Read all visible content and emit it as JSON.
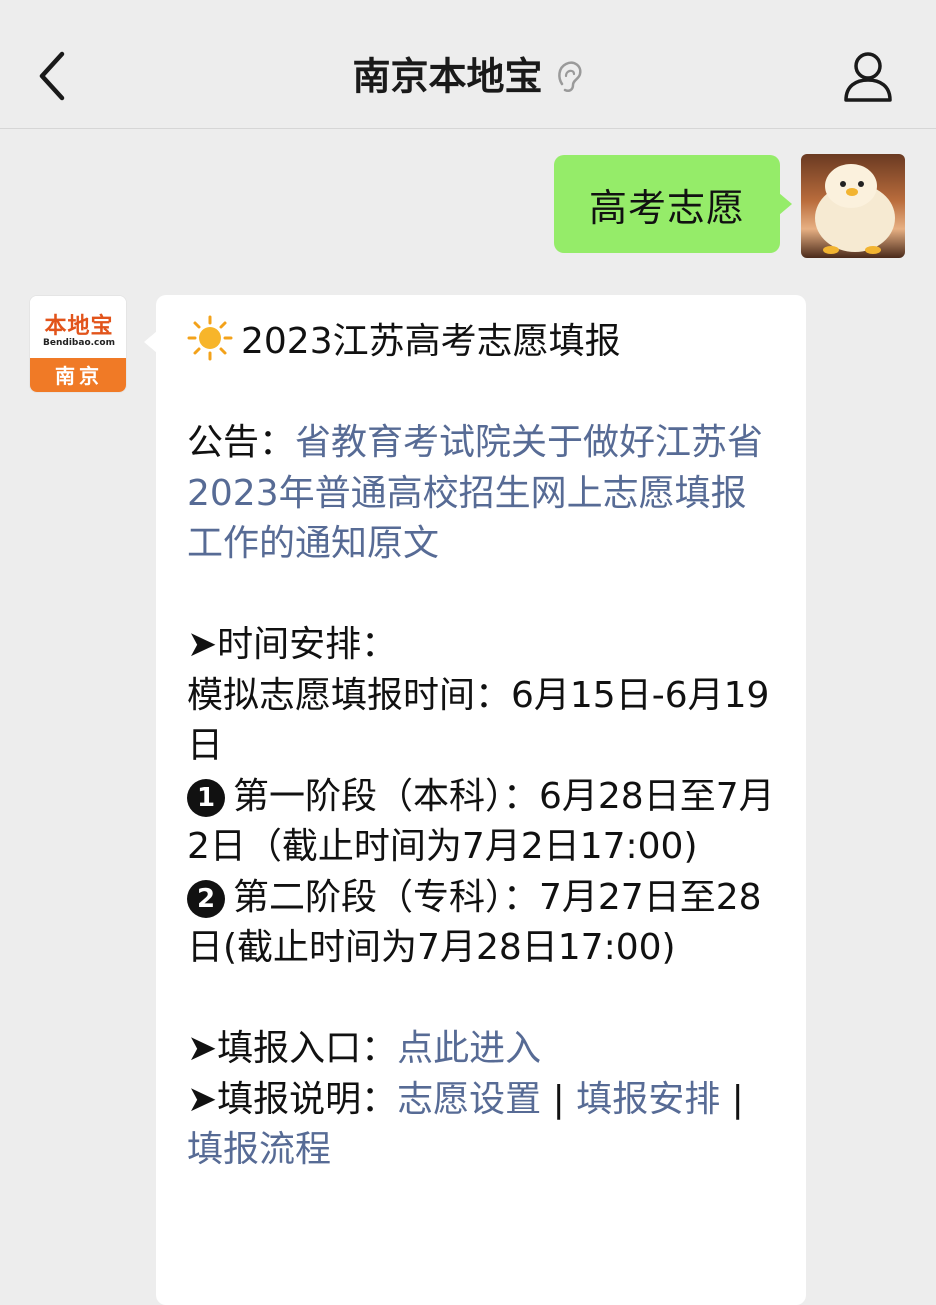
{
  "header": {
    "title": "南京本地宝",
    "back_icon": "chevron-left-icon",
    "ear_icon": "ear-icon",
    "profile_icon": "person-icon"
  },
  "user_message": {
    "text": "高考志愿"
  },
  "bot": {
    "avatar": {
      "brand": "本地宝",
      "domain": "Bendibao.com",
      "city": "南京"
    },
    "title": "2023江苏高考志愿填报",
    "notice_label": "公告：",
    "notice_link": "省教育考试院关于做好江苏省2023年普通高校招生网上志愿填报工作的通知原文",
    "schedule_heading": "➤时间安排：",
    "schedule_sim": "模拟志愿填报时间：6月15日-6月19日",
    "stage1_num": "1",
    "stage1": "第一阶段（本科）：6月28日至7月2日（截止时间为7月2日17:00)",
    "stage2_num": "2",
    "stage2": "第二阶段（专科）：7月27日至28日(截止时间为7月28日17:00)",
    "entry_label": "➤填报入口：",
    "entry_link": "点此进入",
    "guide_label": "➤填报说明：",
    "guide_link_1": "志愿设置",
    "separator_1": " | ",
    "guide_link_2": "填报安排",
    "separator_2": " | ",
    "guide_link_3": "填报流程"
  },
  "colors": {
    "background": "#ededed",
    "user_bubble": "#95ec69",
    "bot_bubble": "#ffffff",
    "link": "#576b95",
    "brand_orange": "#f07a26"
  }
}
